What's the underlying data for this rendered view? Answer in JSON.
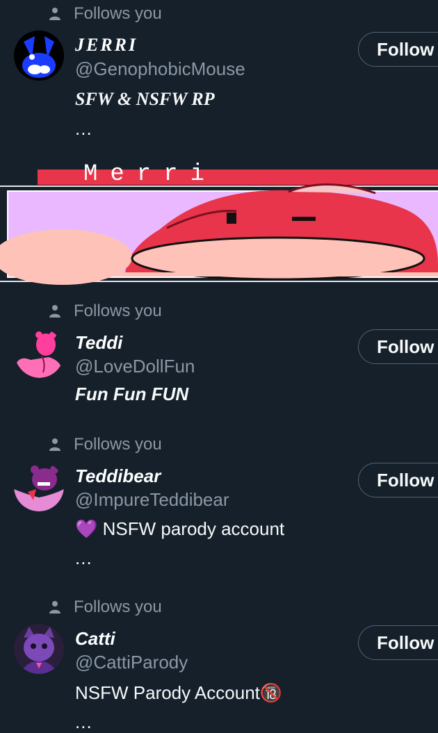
{
  "follows_label": "Follows you",
  "users": [
    {
      "name": "JERRI",
      "handle": "@GenophobicMouse",
      "bio": "SFW & NSFW RP",
      "more": "...",
      "button": "Follow"
    },
    {
      "name": "Teddi",
      "handle": "@LoveDollFun",
      "bio": "Fun Fun FUN",
      "button": "Follow"
    },
    {
      "name": "Teddibear",
      "handle": "@ImpureTeddibear",
      "bio_emoji": "💜",
      "bio": "NSFW parody account",
      "more": "...",
      "button": "Follow"
    },
    {
      "name": "Catti",
      "handle": "@CattiParody",
      "bio": "NSFW Parody Account",
      "bio_emoji": "🔞",
      "more": "...",
      "button": "Follow"
    }
  ],
  "banner_text": "Merri",
  "colors": {
    "background": "#15202b",
    "secondary_text": "#8b98a5",
    "button_border": "#536471"
  }
}
